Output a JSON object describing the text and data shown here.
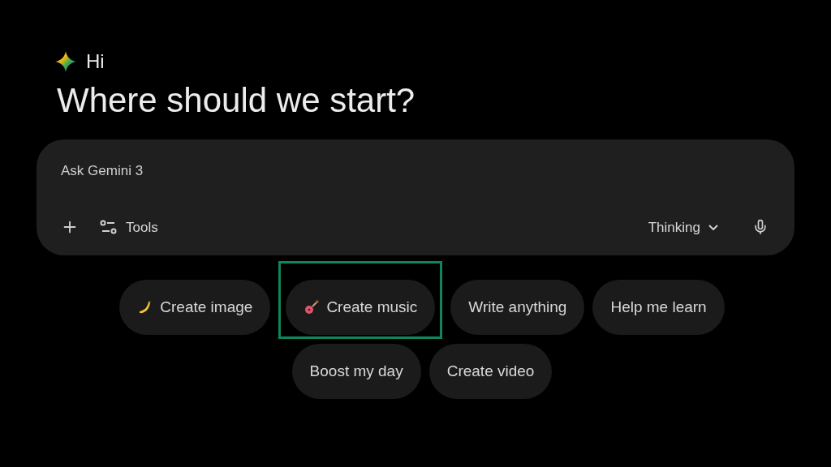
{
  "greeting": "Hi",
  "heading": "Where should we start?",
  "prompt": {
    "placeholder": "Ask Gemini 3",
    "tools_label": "Tools",
    "mode": "Thinking"
  },
  "chip_rows": [
    [
      {
        "label": "Create image",
        "kind": "banana",
        "highlighted": false
      },
      {
        "label": "Create music",
        "kind": "guitar",
        "highlighted": true
      },
      {
        "label": "Write anything",
        "kind": "plain",
        "highlighted": false
      },
      {
        "label": "Help me learn",
        "kind": "plain",
        "highlighted": false
      }
    ],
    [
      {
        "label": "Boost my day",
        "kind": "plain",
        "highlighted": false
      },
      {
        "label": "Create video",
        "kind": "plain",
        "highlighted": false
      }
    ]
  ]
}
